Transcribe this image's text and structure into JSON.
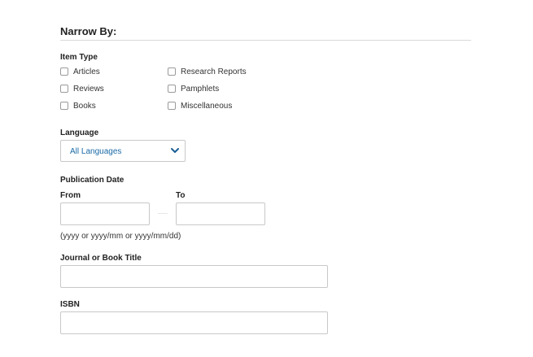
{
  "narrow": {
    "heading": "Narrow By:"
  },
  "item_type": {
    "label": "Item Type",
    "options": [
      {
        "label": "Articles",
        "checked": false
      },
      {
        "label": "Reviews",
        "checked": false
      },
      {
        "label": "Books",
        "checked": false
      },
      {
        "label": "Research Reports",
        "checked": false
      },
      {
        "label": "Pamphlets",
        "checked": false
      },
      {
        "label": "Miscellaneous",
        "checked": false
      }
    ]
  },
  "language": {
    "label": "Language",
    "selected": "All Languages",
    "chevron_icon": "chevron-down-icon",
    "accent_color": "#1a6aa6"
  },
  "publication_date": {
    "label": "Publication Date",
    "from_label": "From",
    "to_label": "To",
    "from_value": "",
    "to_value": "",
    "hint": "(yyyy or yyyy/mm or yyyy/mm/dd)"
  },
  "journal": {
    "label": "Journal or Book Title",
    "value": ""
  },
  "isbn": {
    "label": "ISBN",
    "value": ""
  }
}
